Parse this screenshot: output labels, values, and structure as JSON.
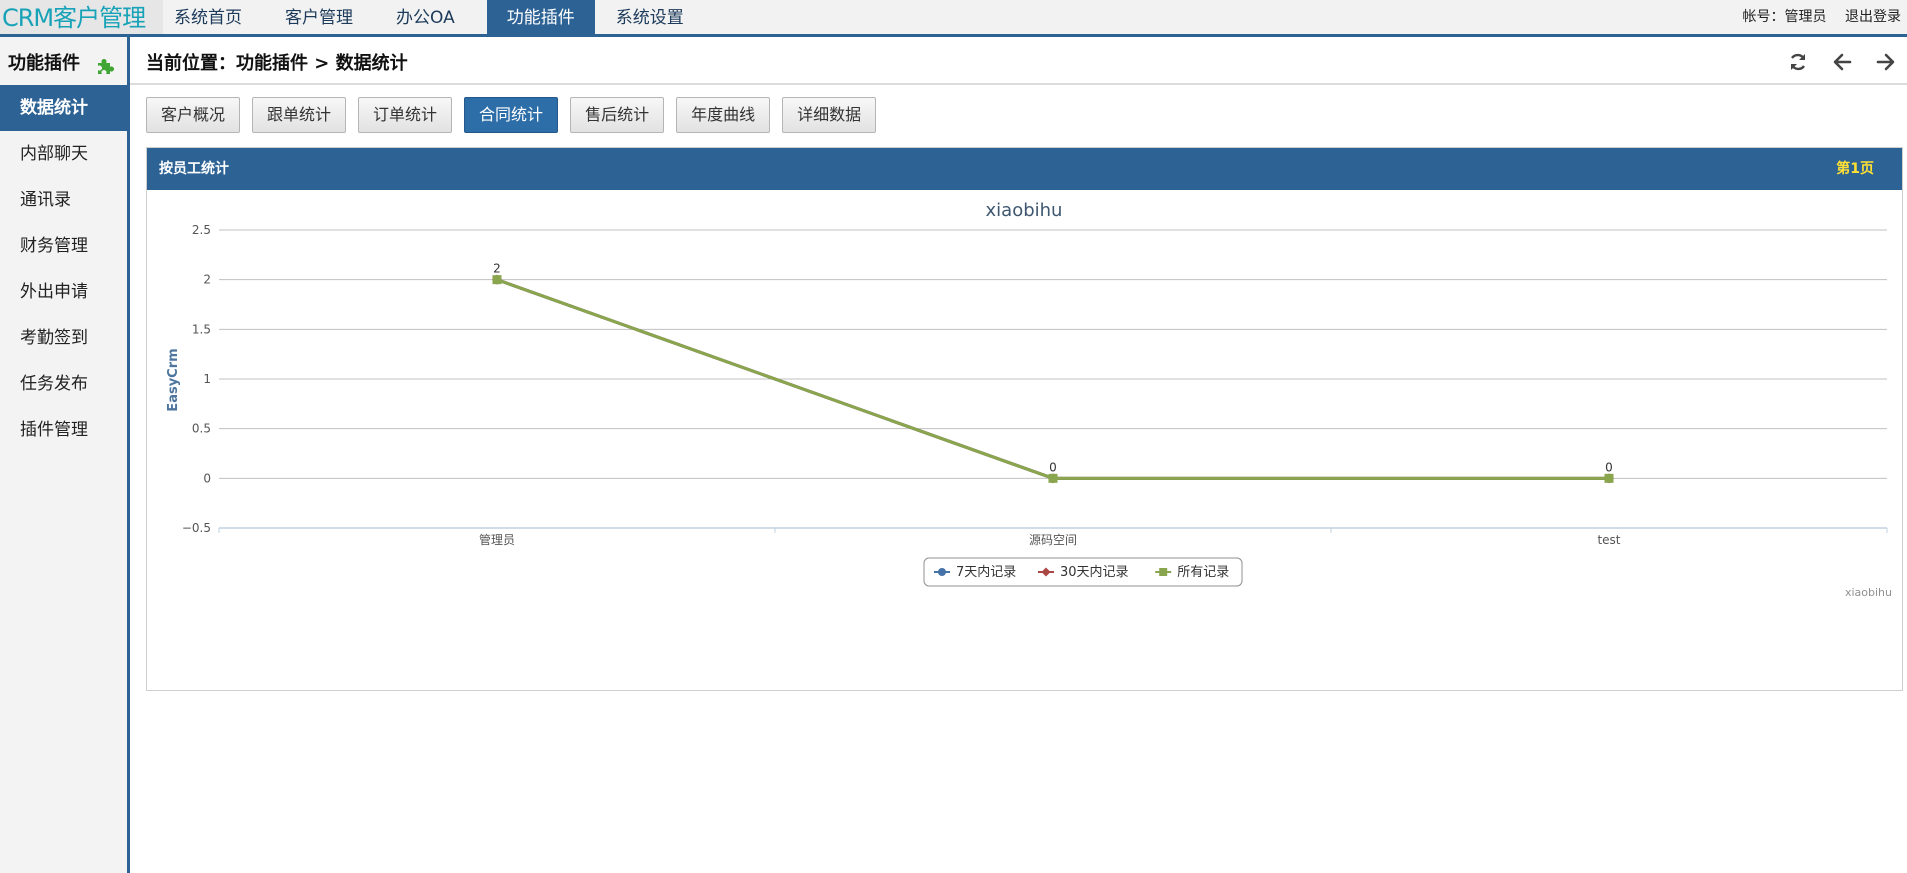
{
  "app": {
    "brand": "CRM客户管理"
  },
  "nav": [
    {
      "label": "系统首页"
    },
    {
      "label": "客户管理"
    },
    {
      "label": "办公OA"
    },
    {
      "label": "功能插件",
      "active": true
    },
    {
      "label": "系统设置"
    }
  ],
  "account": {
    "label": "帐号：管理员",
    "logout": "退出登录"
  },
  "sidebar": {
    "title": "功能插件",
    "title_icon": "puzzle-icon",
    "items": [
      {
        "label": "数据统计",
        "active": true
      },
      {
        "label": "内部聊天"
      },
      {
        "label": "通讯录"
      },
      {
        "label": "财务管理"
      },
      {
        "label": "外出申请"
      },
      {
        "label": "考勤签到"
      },
      {
        "label": "任务发布"
      },
      {
        "label": "插件管理"
      }
    ]
  },
  "breadcrumb": {
    "text": "当前位置：功能插件 > 数据统计"
  },
  "toolbar_icons": [
    "refresh-icon",
    "arrow-left-icon",
    "arrow-right-icon"
  ],
  "tabs": [
    {
      "label": "客户概况"
    },
    {
      "label": "跟单统计"
    },
    {
      "label": "订单统计"
    },
    {
      "label": "合同统计",
      "active": true
    },
    {
      "label": "售后统计"
    },
    {
      "label": "年度曲线"
    },
    {
      "label": "详细数据"
    }
  ],
  "panel": {
    "title": "按员工统计",
    "page": "第1页"
  },
  "colors": {
    "primary": "#2d6295",
    "brand": "#17a2b8",
    "page_label": "#ffe033",
    "series_7d": "#4572a7",
    "series_30d": "#aa4643",
    "series_all": "#89a54e"
  },
  "chart_data": {
    "type": "line",
    "title": "xiaobihu",
    "ylabel": "EasyCrm",
    "xlabel": "",
    "categories": [
      "管理员",
      "源码空间",
      "test"
    ],
    "ylim": [
      -0.5,
      2.5
    ],
    "yticks": [
      "2.5",
      "2",
      "1.5",
      "1",
      "0.5",
      "0",
      "−0.5"
    ],
    "series": [
      {
        "name": "7天内记录",
        "values": [
          2,
          0,
          0
        ],
        "color": "#4572a7",
        "marker": "circle"
      },
      {
        "name": "30天内记录",
        "values": [
          2,
          0,
          0
        ],
        "color": "#aa4643",
        "marker": "diamond"
      },
      {
        "name": "所有记录",
        "values": [
          2,
          0,
          0
        ],
        "color": "#89a54e",
        "marker": "square"
      }
    ],
    "data_labels": [
      "2",
      "0",
      "0"
    ],
    "credit": "xiaobihu",
    "grid": true,
    "legend_position": "bottom-center"
  }
}
